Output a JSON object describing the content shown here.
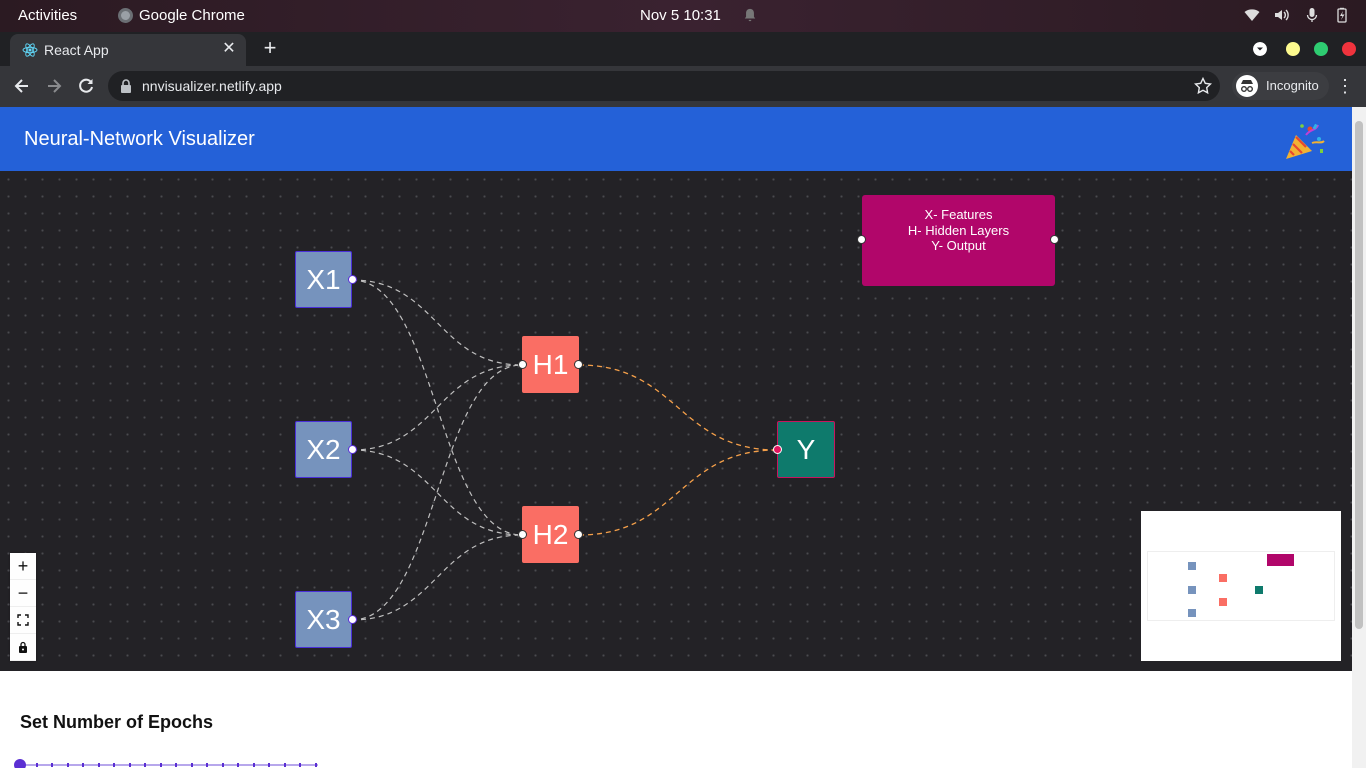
{
  "system": {
    "activities": "Activities",
    "app_name": "Google Chrome",
    "clock": "Nov 5  10:31"
  },
  "browser": {
    "tab_title": "React App",
    "url": "nnvisualizer.netlify.app",
    "incognito_label": "Incognito",
    "window_controls": [
      "#fdfa8e",
      "#2ecc71",
      "#f0333d"
    ]
  },
  "app": {
    "title": "Neural-Network Visualizer",
    "header_color": "#2461d8"
  },
  "graph": {
    "nodes": {
      "x1": "X1",
      "x2": "X2",
      "x3": "X3",
      "h1": "H1",
      "h2": "H2",
      "y": "Y"
    },
    "legend": {
      "line1": "X- Features",
      "line2": "H- Hidden Layers",
      "line3": "Y- Output"
    },
    "colors": {
      "input": "#7693bd",
      "hidden": "#fa6e64",
      "output": "#0e7a6c",
      "legend": "#b1066a",
      "edge_input": "#bfbfbf",
      "edge_hidden": "#f5a04a"
    }
  },
  "controls": {
    "zoom_in": "+",
    "zoom_out": "−"
  },
  "epochs": {
    "title": "Set Number of Epochs",
    "slider_value_fraction": 0
  }
}
